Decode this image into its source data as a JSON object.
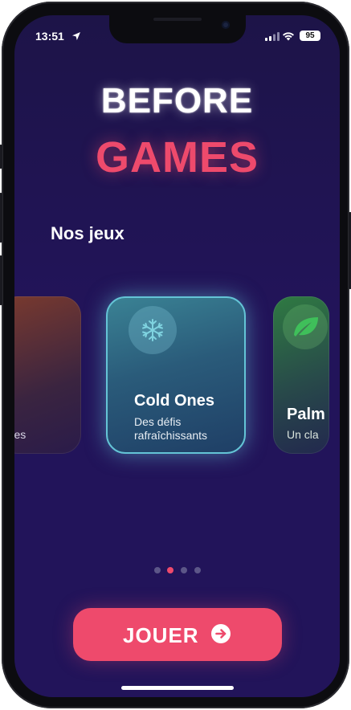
{
  "status_bar": {
    "time": "13:51",
    "battery": "95"
  },
  "header": {
    "title_line1": "BEFORE",
    "title_line2": "GAMES"
  },
  "section_title": "Nos jeux",
  "games": [
    {
      "name": "",
      "description": "ntées",
      "icon": "unknown-icon",
      "color": "#7a3a2e"
    },
    {
      "name": "Cold Ones",
      "description": "Des défis rafraîchissants",
      "icon": "snowflake-icon",
      "color": "#64c4d6"
    },
    {
      "name": "Palm",
      "description": "Un cla",
      "icon": "leaf-icon",
      "color": "#2f7a42"
    }
  ],
  "pagination": {
    "total": 4,
    "active_index": 1
  },
  "play_button": {
    "label": "JOUER",
    "icon": "arrow-right-circle-icon"
  },
  "colors": {
    "accent": "#ee4a6c",
    "background": "#22145a",
    "card_highlight": "#64c4d6"
  }
}
